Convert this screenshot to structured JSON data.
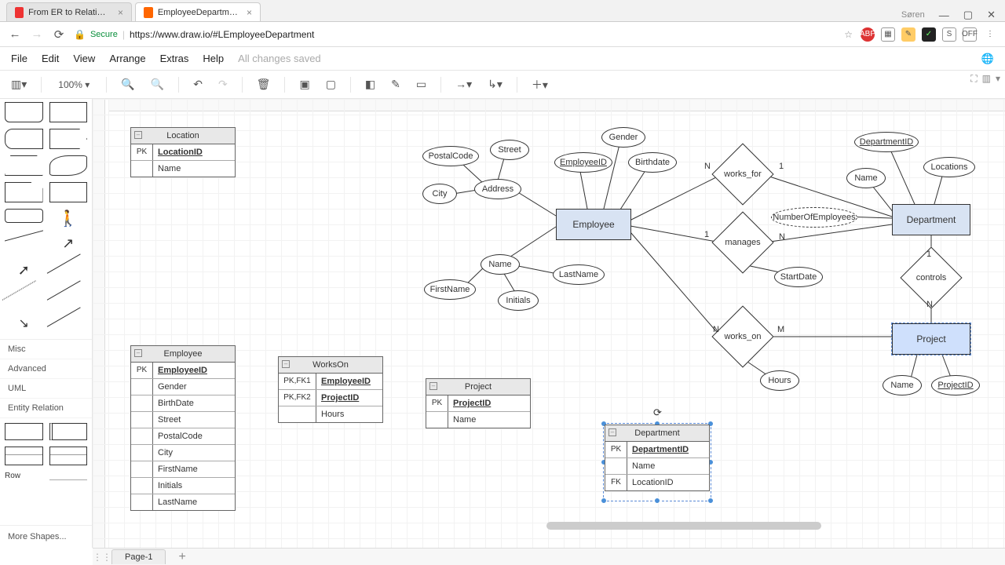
{
  "browser": {
    "tabs": [
      {
        "title": "From ER to Relational M…",
        "favicon": "#4a7"
      },
      {
        "title": "EmployeeDepartment - d",
        "favicon": "#f60"
      }
    ],
    "user": "Søren",
    "secure_label": "Secure",
    "url": "https://www.draw.io/#LEmployeeDepartment"
  },
  "menu": {
    "items": [
      "File",
      "Edit",
      "View",
      "Arrange",
      "Extras",
      "Help"
    ],
    "status": "All changes saved"
  },
  "toolbar": {
    "zoom": "100%"
  },
  "sidebar": {
    "sections": [
      "Misc",
      "Advanced",
      "UML",
      "Entity Relation"
    ],
    "row_label": "Row",
    "more": "More Shapes..."
  },
  "page": {
    "tab": "Page-1"
  },
  "er": {
    "entities": {
      "employee": "Employee",
      "department": "Department",
      "project": "Project"
    },
    "rels": {
      "works_for": "works_for",
      "manages": "manages",
      "works_on": "works_on",
      "controls": "controls"
    },
    "card": {
      "one": "1",
      "n": "N",
      "m": "M"
    },
    "attrs": {
      "postalcode": "PostalCode",
      "street": "Street",
      "city": "City",
      "address": "Address",
      "employeeid": "EmployeeID",
      "gender": "Gender",
      "birthdate": "Birthdate",
      "name": "Name",
      "firstname": "FirstName",
      "lastname": "LastName",
      "initials": "Initials",
      "numemp": "NumberOfEmployees",
      "startdate": "StartDate",
      "deptid": "DepartmentID",
      "locations": "Locations",
      "dname": "Name",
      "hours": "Hours",
      "pname": "Name",
      "projectid": "ProjectID"
    }
  },
  "tables": {
    "location": {
      "title": "Location",
      "rows": [
        {
          "k": "PK",
          "v": "LocationID",
          "pk": true
        },
        {
          "k": "",
          "v": "Name"
        }
      ]
    },
    "employee": {
      "title": "Employee",
      "rows": [
        {
          "k": "PK",
          "v": "EmployeeID",
          "pk": true
        },
        {
          "k": "",
          "v": "Gender"
        },
        {
          "k": "",
          "v": "BirthDate"
        },
        {
          "k": "",
          "v": "Street"
        },
        {
          "k": "",
          "v": "PostalCode"
        },
        {
          "k": "",
          "v": "City"
        },
        {
          "k": "",
          "v": "FirstName"
        },
        {
          "k": "",
          "v": "Initials"
        },
        {
          "k": "",
          "v": "LastName"
        }
      ]
    },
    "workson": {
      "title": "WorksOn",
      "rows": [
        {
          "k": "PK,FK1",
          "v": "EmployeeID",
          "pk": true
        },
        {
          "k": "PK,FK2",
          "v": "ProjectID",
          "pk": true
        },
        {
          "k": "",
          "v": "Hours"
        }
      ]
    },
    "project": {
      "title": "Project",
      "rows": [
        {
          "k": "PK",
          "v": "ProjectID",
          "pk": true
        },
        {
          "k": "",
          "v": "Name"
        }
      ]
    },
    "department": {
      "title": "Department",
      "rows": [
        {
          "k": "PK",
          "v": "DepartmentID",
          "pk": true
        },
        {
          "k": "",
          "v": "Name"
        },
        {
          "k": "FK",
          "v": "LocationID"
        }
      ]
    }
  }
}
